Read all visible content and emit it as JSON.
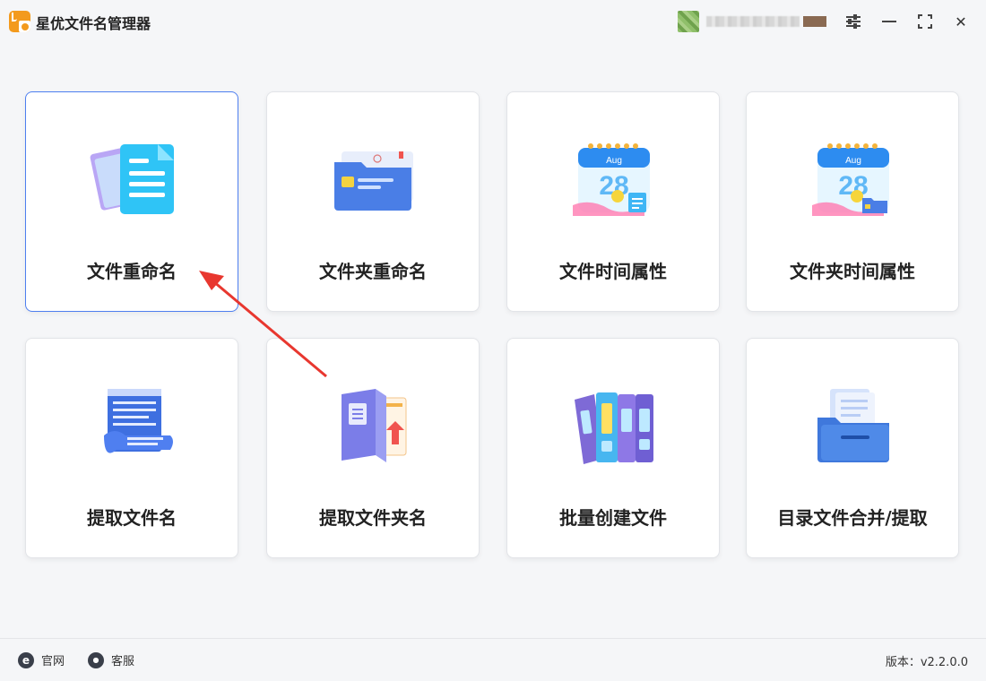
{
  "app": {
    "title": "星优文件名管理器",
    "logo_icon": "app-logo-icon"
  },
  "window_controls": {
    "settings_icon": "settings-sliders-icon",
    "minimize_icon": "minimize-icon",
    "maximize_icon": "maximize-icon",
    "close_icon": "close-icon",
    "close_glyph": "✕"
  },
  "cards": [
    {
      "label": "文件重命名",
      "icon": "document-rename-icon",
      "active": true
    },
    {
      "label": "文件夹重命名",
      "icon": "folder-rename-icon",
      "active": false
    },
    {
      "label": "文件时间属性",
      "icon": "calendar-file-icon",
      "active": false
    },
    {
      "label": "文件夹时间属性",
      "icon": "calendar-folder-icon",
      "active": false
    },
    {
      "label": "提取文件名",
      "icon": "scroll-list-icon",
      "active": false
    },
    {
      "label": "提取文件夹名",
      "icon": "folder-extract-icon",
      "active": false
    },
    {
      "label": "批量创建文件",
      "icon": "binders-icon",
      "active": false
    },
    {
      "label": "目录文件合并/提取",
      "icon": "file-box-icon",
      "active": false
    }
  ],
  "calendar": {
    "month": "Aug",
    "day": "28"
  },
  "footer": {
    "website_label": "官网",
    "website_icon_glyph": "e",
    "support_label": "客服",
    "support_icon_glyph": "●",
    "version": "版本：v2.2.0.0"
  },
  "colors": {
    "accent": "#4e7ff0",
    "annotation_arrow": "#e8372f",
    "logo": "#f39a1d"
  }
}
